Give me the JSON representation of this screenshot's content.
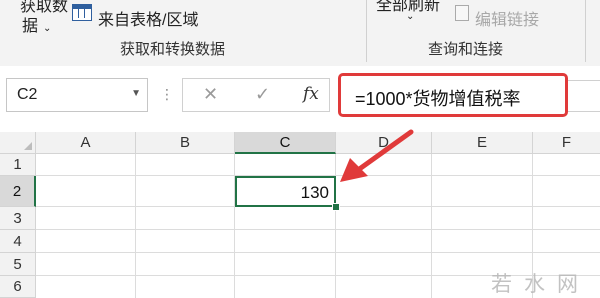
{
  "ribbon": {
    "get_data_top": "获取数",
    "get_data_bottom": "据",
    "from_table_label": "来自表格/区域",
    "group1_label": "获取和转换数据",
    "refresh_top": "全部刷新",
    "edit_links_label": "编辑链接",
    "group2_label": "查询和连接"
  },
  "formula_bar": {
    "name_box_value": "C2",
    "cancel_symbol": "✕",
    "enter_symbol": "✓",
    "fx_label": "fx",
    "formula": "=1000*货物增值税率"
  },
  "grid": {
    "columns": [
      "A",
      "B",
      "C",
      "D",
      "E",
      "F"
    ],
    "rows": [
      "1",
      "2",
      "3",
      "4",
      "5",
      "6"
    ],
    "active_cell_value": "130"
  },
  "annotation": {
    "highlight_color": "#e03a3a"
  },
  "watermark": "若水网"
}
